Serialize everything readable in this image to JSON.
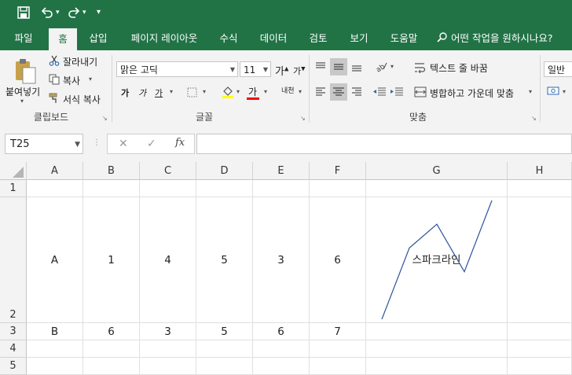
{
  "qat": {
    "save_icon": "save-icon",
    "undo_icon": "undo-icon",
    "redo_icon": "redo-icon",
    "customize_icon": "qat-customize-icon"
  },
  "tabs": [
    "파일",
    "홈",
    "삽입",
    "페이지 레이아웃",
    "수식",
    "데이터",
    "검토",
    "보기",
    "도움말"
  ],
  "tell_me": "어떤 작업을 원하시나요?",
  "clipboard": {
    "paste": "붙여넣기",
    "cut": "잘라내기",
    "copy": "복사",
    "format_painter": "서식 복사",
    "group": "클립보드"
  },
  "font": {
    "name": "맑은 고딕",
    "size": "11",
    "grow": "가",
    "shrink": "가",
    "bold": "가",
    "italic": "가",
    "underline": "가",
    "color": "가",
    "phonetic": "내천",
    "group": "글꼴"
  },
  "alignment": {
    "wrap": "텍스트 줄 바꿈",
    "merge": "병합하고 가운데 맞춤",
    "group": "맞춤",
    "orientation_label": "ab"
  },
  "number": {
    "format": "일반"
  },
  "formula_bar": {
    "name_box": "T25",
    "fx": "fx",
    "cancel": "✕",
    "enter": "✓",
    "value": ""
  },
  "columns": [
    "A",
    "B",
    "C",
    "D",
    "E",
    "F",
    "G",
    "H"
  ],
  "rows": [
    {
      "num": "1",
      "cells": [
        "",
        "",
        "",
        "",
        "",
        "",
        "",
        ""
      ]
    },
    {
      "num": "2",
      "cells": [
        "A",
        "1",
        "4",
        "5",
        "3",
        "6",
        "스파크라인",
        ""
      ]
    },
    {
      "num": "3",
      "cells": [
        "B",
        "6",
        "3",
        "5",
        "6",
        "7",
        "",
        ""
      ]
    },
    {
      "num": "4",
      "cells": [
        "",
        "",
        "",
        "",
        "",
        "",
        "",
        ""
      ]
    },
    {
      "num": "5",
      "cells": [
        "",
        "",
        "",
        "",
        "",
        "",
        "",
        ""
      ]
    }
  ],
  "sparkline": {
    "values": [
      1,
      4,
      5,
      3,
      6
    ],
    "color": "#2f5597"
  },
  "colors": {
    "accent": "#217346",
    "font_color_bar": "#ff0000"
  }
}
